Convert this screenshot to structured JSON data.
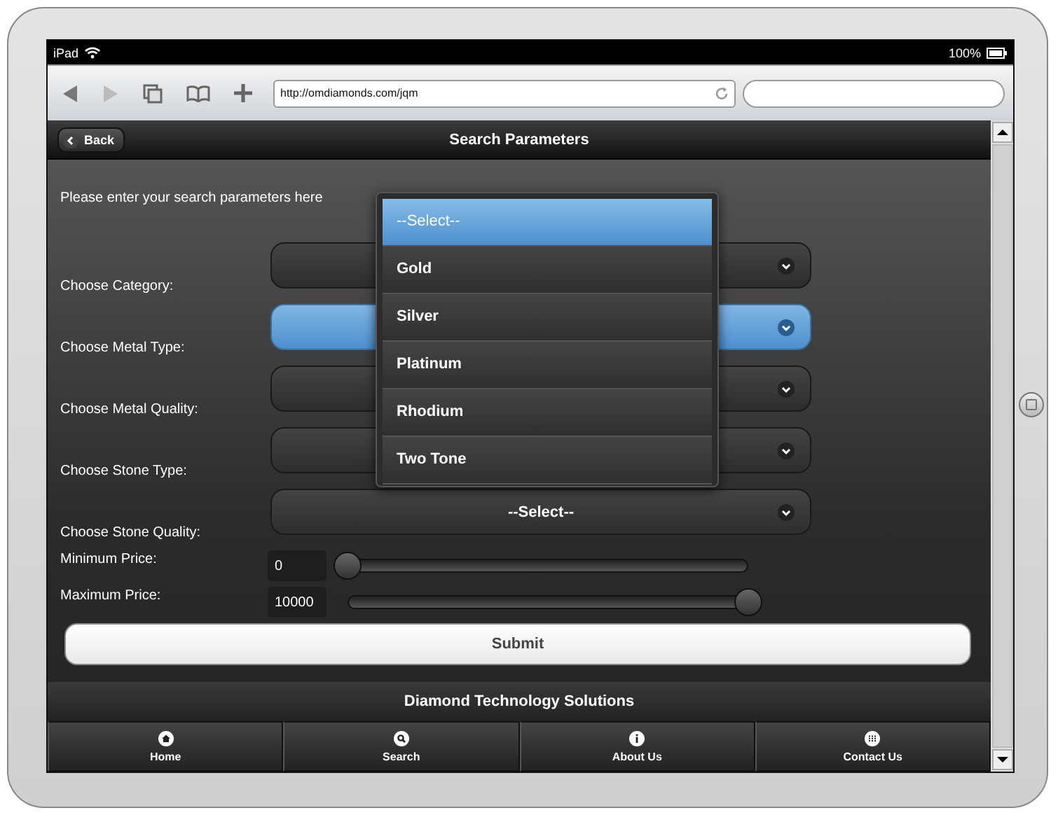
{
  "status_bar": {
    "device": "iPad",
    "battery": "100%"
  },
  "browser": {
    "url": "http://omdiamonds.com/jqm"
  },
  "header": {
    "back": "Back",
    "title": "Search Parameters"
  },
  "intro": "Please enter your search parameters here",
  "fields": [
    {
      "label": "Choose Category:",
      "focused": false
    },
    {
      "label": "Choose Metal Type:",
      "focused": true
    },
    {
      "label": "Choose Metal Quality:",
      "focused": false
    },
    {
      "label": "Choose Stone Type:",
      "focused": false
    },
    {
      "label": "Choose Stone Quality:",
      "focused": false,
      "value": "--Select--"
    }
  ],
  "dropdown": {
    "options": [
      {
        "label": "--Select--",
        "selected": true
      },
      {
        "label": "Gold",
        "selected": false
      },
      {
        "label": "Silver",
        "selected": false
      },
      {
        "label": "Platinum",
        "selected": false
      },
      {
        "label": "Rhodium",
        "selected": false
      },
      {
        "label": "Two Tone",
        "selected": false
      }
    ]
  },
  "prices": [
    {
      "label": "Minimum Price:",
      "value": "0",
      "level": 0
    },
    {
      "label": "Maximum Price:",
      "value": "10000",
      "level": 1
    }
  ],
  "submit": "Submit",
  "footer": "Diamond Technology Solutions",
  "nav": [
    {
      "label": "Home",
      "kind": "home"
    },
    {
      "label": "Search",
      "kind": "search"
    },
    {
      "label": "About Us",
      "kind": "info"
    },
    {
      "label": "Contact Us",
      "kind": "grid"
    }
  ]
}
